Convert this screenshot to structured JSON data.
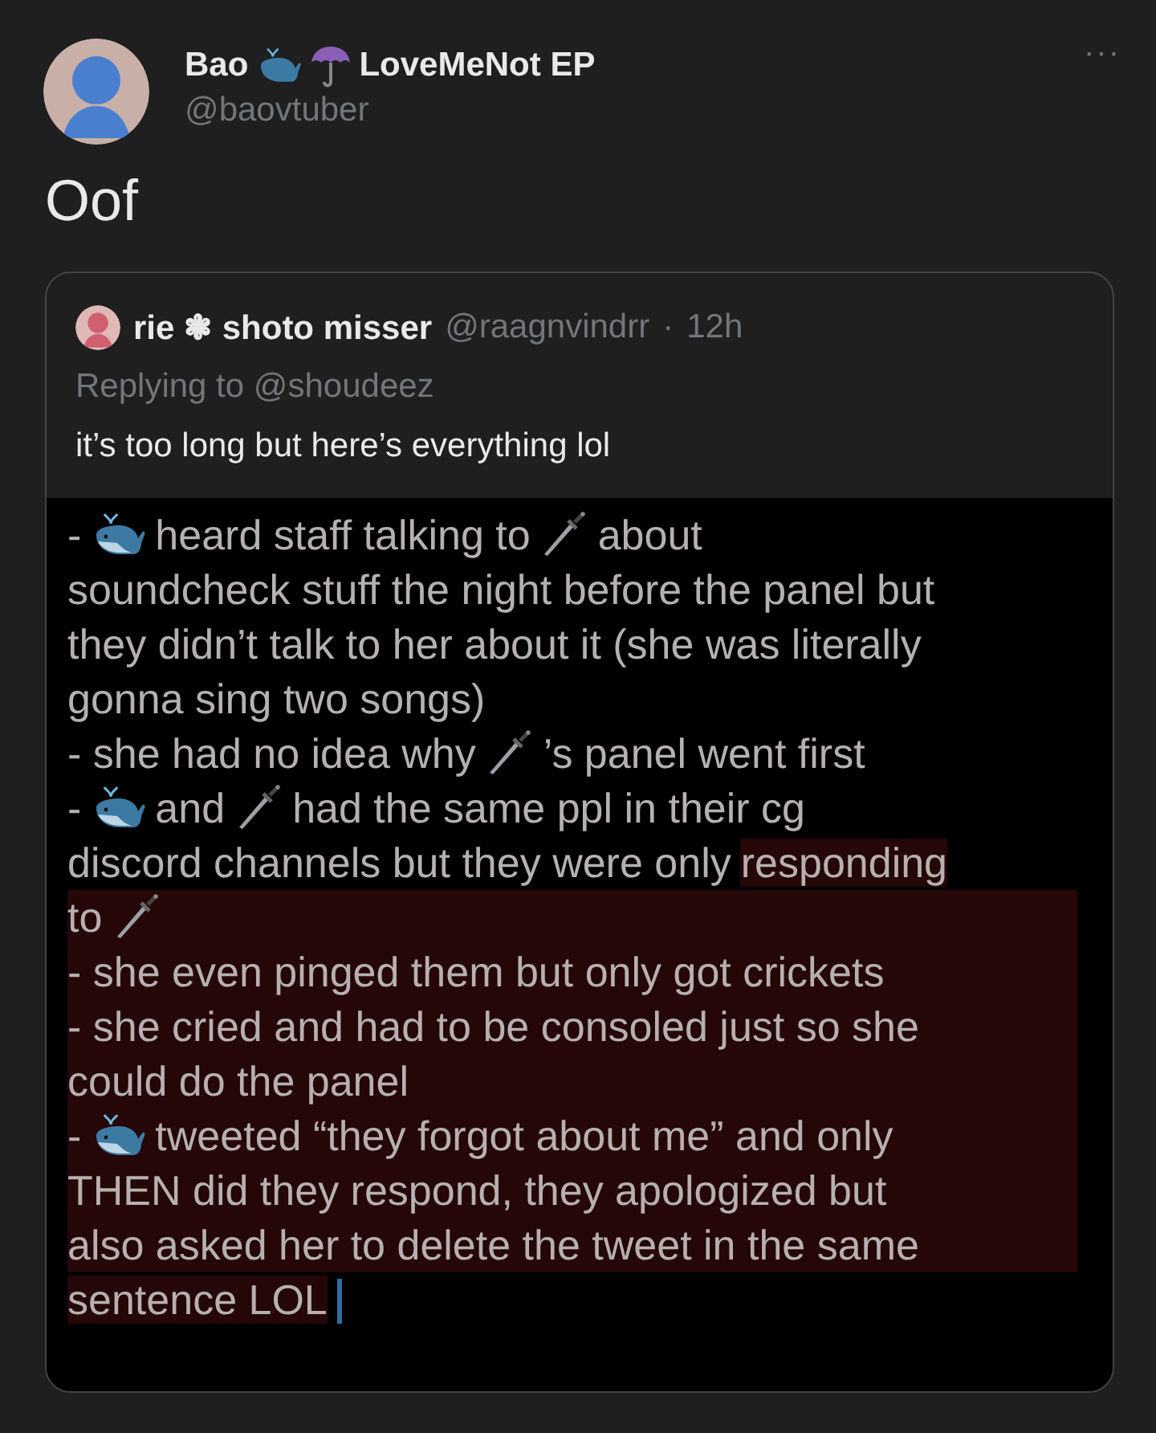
{
  "tweet": {
    "name": "Bao",
    "name_suffix": "LoveMeNot EP",
    "handle": "@baovtuber",
    "text": "Oof",
    "more": "···"
  },
  "quote": {
    "name": "rie ❃ shoto misser",
    "handle": "@raagnvindrr",
    "separator": "·",
    "time": "12h",
    "replying_label": "Replying to",
    "replying_handle": "@shoudeez",
    "text": "it’s too long but here’s everything lol",
    "image_lines": [
      {
        "highlighted": false,
        "segments": [
          {
            "kind": "text",
            "text": "-"
          },
          {
            "kind": "whale"
          },
          {
            "kind": "text",
            "text": "heard staff talking to"
          },
          {
            "kind": "dagger"
          },
          {
            "kind": "text",
            "text": "about"
          }
        ]
      },
      {
        "highlighted": false,
        "segments": [
          {
            "kind": "text",
            "text": "soundcheck stuff the night before the panel but"
          }
        ]
      },
      {
        "highlighted": false,
        "segments": [
          {
            "kind": "text",
            "text": "they didn’t talk to her about it (she was literally"
          }
        ]
      },
      {
        "highlighted": false,
        "segments": [
          {
            "kind": "text",
            "text": "gonna sing two songs)"
          }
        ]
      },
      {
        "highlighted": false,
        "segments": [
          {
            "kind": "text",
            "text": "- she had no idea why"
          },
          {
            "kind": "dagger"
          },
          {
            "kind": "text",
            "text": "’s panel went first"
          }
        ]
      },
      {
        "highlighted": false,
        "segments": [
          {
            "kind": "text",
            "text": "-"
          },
          {
            "kind": "whale"
          },
          {
            "kind": "text",
            "text": "and"
          },
          {
            "kind": "dagger"
          },
          {
            "kind": "text",
            "text": "had the same ppl in their cg"
          }
        ]
      },
      {
        "highlighted": false,
        "segments": [
          {
            "kind": "text",
            "text": "discord channels but they were only"
          },
          {
            "kind": "text",
            "text": "responding",
            "highlighted": true
          }
        ]
      },
      {
        "highlighted": true,
        "segments": [
          {
            "kind": "text",
            "text": "to"
          },
          {
            "kind": "dagger"
          }
        ]
      },
      {
        "highlighted": true,
        "segments": [
          {
            "kind": "text",
            "text": "- she even pinged them but only got crickets"
          }
        ]
      },
      {
        "highlighted": true,
        "segments": [
          {
            "kind": "text",
            "text": "- she cried and had to be consoled just so she"
          }
        ]
      },
      {
        "highlighted": true,
        "segments": [
          {
            "kind": "text",
            "text": "could do the panel"
          }
        ]
      },
      {
        "highlighted": true,
        "segments": [
          {
            "kind": "text",
            "text": "-"
          },
          {
            "kind": "whale"
          },
          {
            "kind": "text",
            "text": "tweeted “they forgot about me” and only"
          }
        ]
      },
      {
        "highlighted": true,
        "segments": [
          {
            "kind": "text",
            "text": "THEN did they respond, they apologized but"
          }
        ]
      },
      {
        "highlighted": true,
        "segments": [
          {
            "kind": "text",
            "text": "also asked her to delete the tweet in the same"
          }
        ]
      },
      {
        "highlighted": false,
        "cursor": true,
        "segments": [
          {
            "kind": "text",
            "text": "sentence LOL",
            "highlighted": true
          }
        ]
      }
    ]
  }
}
